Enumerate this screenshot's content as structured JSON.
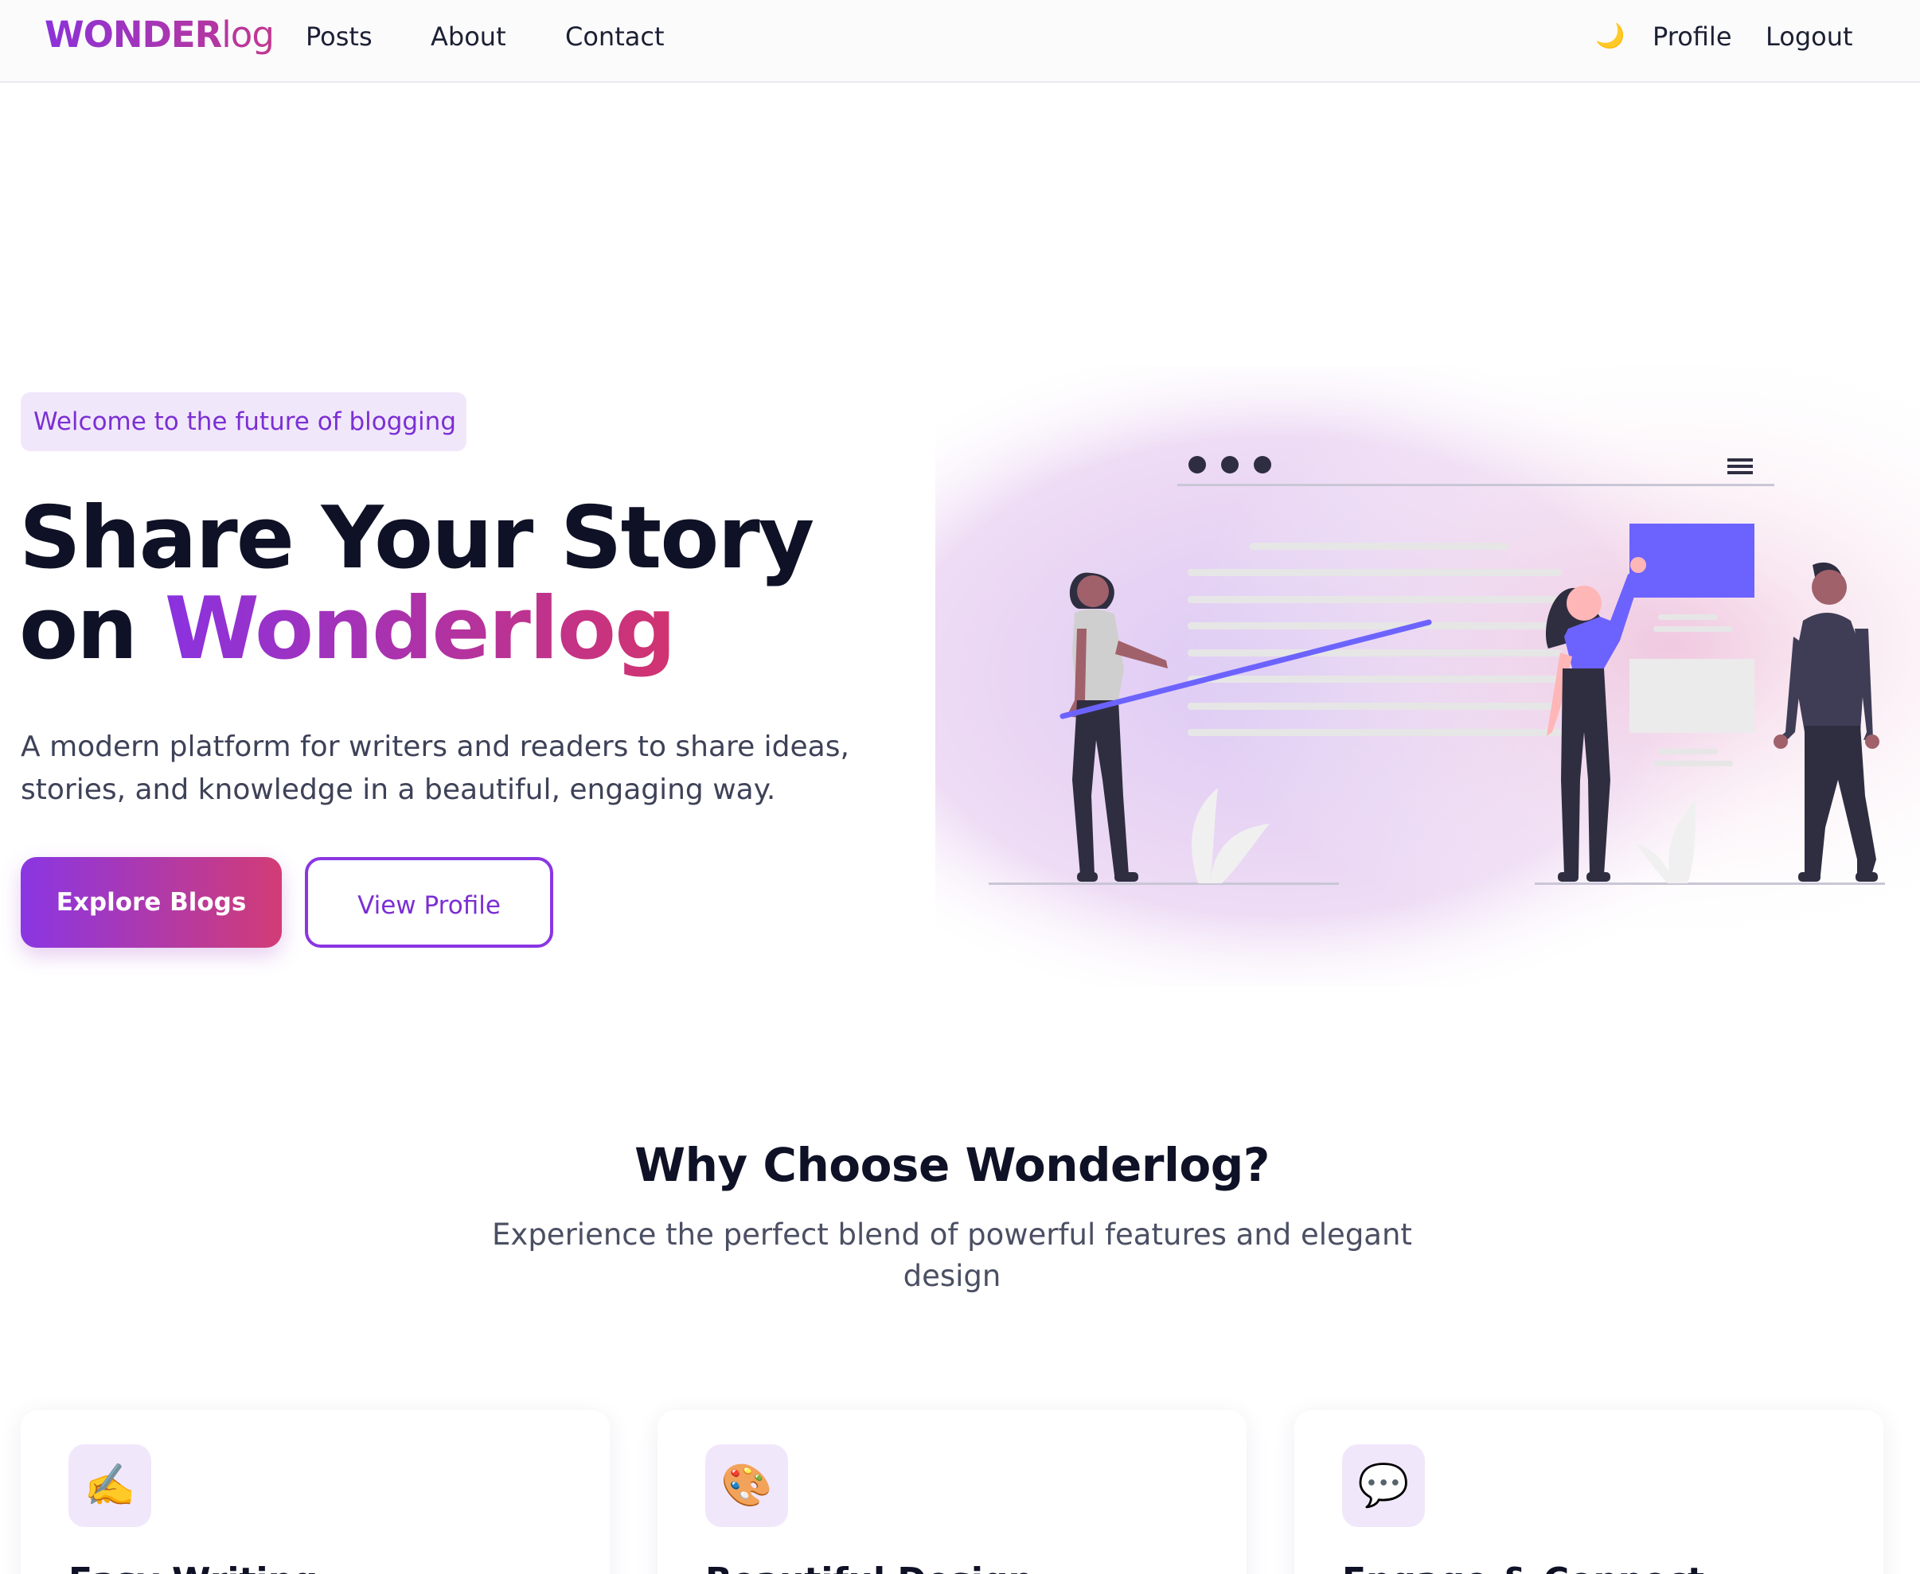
{
  "nav": {
    "logo_bold": "WONDER",
    "logo_light": "log",
    "links": [
      "Posts",
      "About",
      "Contact"
    ],
    "theme_toggle": "🌙",
    "profile": "Profile",
    "logout": "Logout"
  },
  "hero": {
    "badge": "Welcome to the future of blogging",
    "title_line1": "Share Your Story",
    "title_line2_prefix": "on ",
    "title_line2_highlight": "Wonderlog",
    "description": "A modern platform for writers and readers to share ideas, stories, and knowledge in a beautiful, engaging way.",
    "primary_button": "Explore Blogs",
    "secondary_button": "View Profile"
  },
  "features": {
    "title": "Why Choose Wonderlog?",
    "subtitle": "Experience the perfect blend of powerful features and elegant design",
    "cards": [
      {
        "icon": "✍️",
        "icon_name": "writing-hand-icon",
        "title": "Easy Writing"
      },
      {
        "icon": "🎨",
        "icon_name": "palette-icon",
        "title": "Beautiful Design"
      },
      {
        "icon": "💬",
        "icon_name": "speech-bubble-icon",
        "title": "Engage & Connect"
      }
    ]
  },
  "colors": {
    "accent_purple": "#8a32e0",
    "accent_pink": "#d2336f",
    "illustration_blue": "#6c63ff",
    "text_dark": "#0f1226"
  }
}
